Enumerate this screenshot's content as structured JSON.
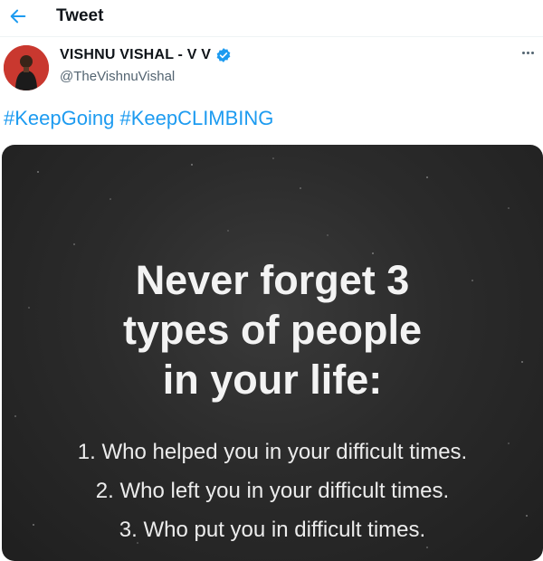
{
  "header": {
    "title": "Tweet",
    "back_icon": "arrow-left-icon"
  },
  "author": {
    "display_name": "VISHNU VISHAL - V V",
    "handle": "@TheVishnuVishal",
    "verified_icon": "verified-badge-icon",
    "more_icon": "more-options-icon"
  },
  "tweet": {
    "hashtags": [
      "#KeepGoing",
      "#KeepCLIMBING"
    ]
  },
  "image": {
    "headline": [
      "Never forget 3",
      "types of people",
      "in your life:"
    ],
    "items": [
      "1. Who helped you in your difficult times.",
      "2. Who left you in your difficult times.",
      "3. Who put you in difficult times."
    ]
  },
  "colors": {
    "link": "#1d9bf0",
    "verified": "#1d9bf0",
    "image_bg": "#2b2b2b",
    "avatar_bg": "#c9382f"
  }
}
